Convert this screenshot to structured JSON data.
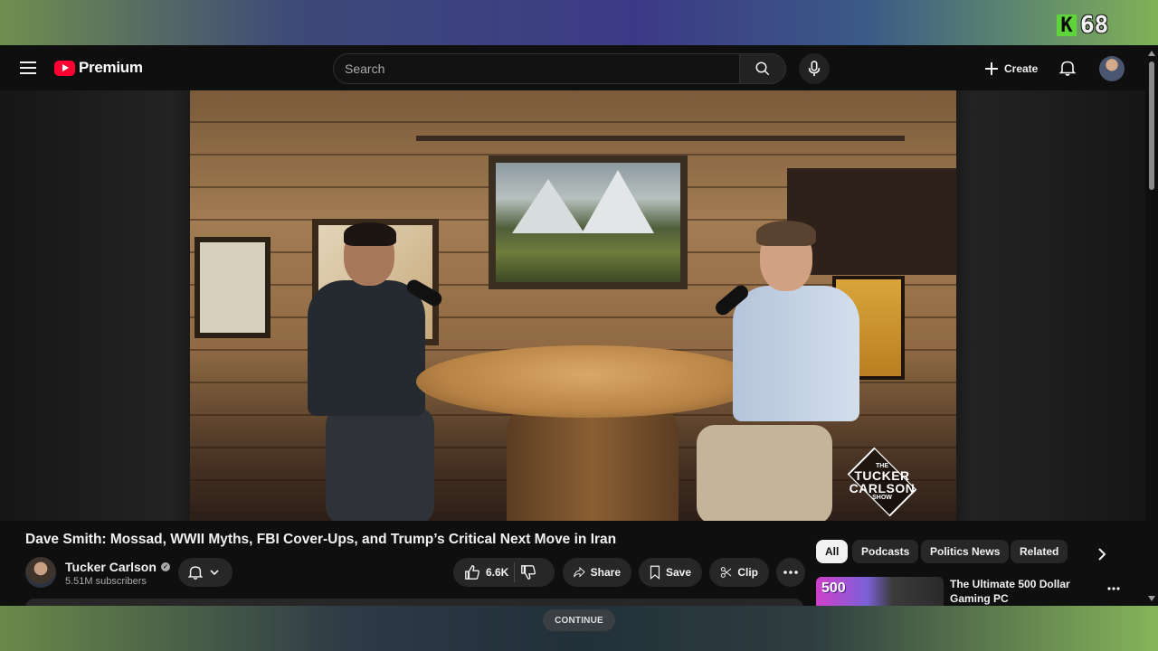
{
  "overlay": {
    "badge_letter": "K",
    "badge_number": "68",
    "continue_label": "CONTINUE"
  },
  "header": {
    "logo_word": "Premium",
    "search_placeholder": "Search",
    "create_label": "Create"
  },
  "video": {
    "title": "Dave Smith: Mossad, WWII Myths, FBI Cover-Ups, and Trump’s Critical Next Move in Iran",
    "watermark_small_top": "THE",
    "watermark_line1": "TUCKER",
    "watermark_line2": "CARLSON",
    "watermark_small_bottom": "SHOW"
  },
  "channel": {
    "name": "Tucker Carlson",
    "subscribers": "5.51M subscribers"
  },
  "actions": {
    "like_count": "6.6K",
    "share_label": "Share",
    "save_label": "Save",
    "clip_label": "Clip"
  },
  "chips": [
    {
      "label": "All",
      "active": true
    },
    {
      "label": "Podcasts",
      "active": false
    },
    {
      "label": "Politics News",
      "active": false
    },
    {
      "label": "Related",
      "active": false
    }
  ],
  "recommendation": {
    "thumb_text": "500",
    "title": "The Ultimate 500 Dollar Gaming PC"
  },
  "colors": {
    "brand_red": "#ff0033",
    "background": "#0f0f0f",
    "pill": "#272727"
  }
}
